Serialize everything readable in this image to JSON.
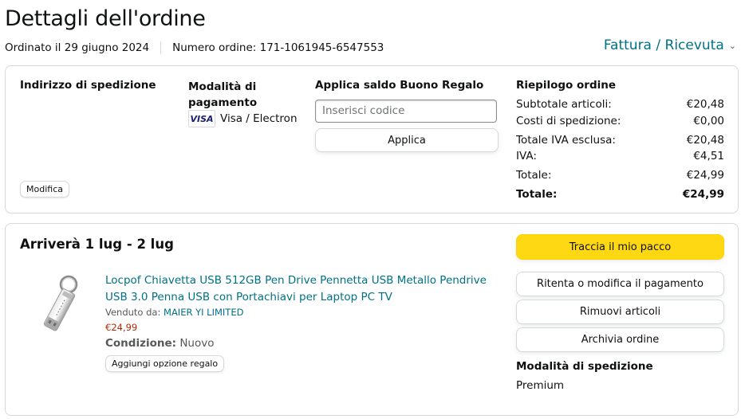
{
  "page": {
    "title": "Dettagli dell'ordine",
    "ordered_on": "Ordinato il 29 giugno 2024",
    "order_number": "Numero ordine: 171-1061945-6547553",
    "invoice_link": "Fattura / Ricevuta"
  },
  "summary": {
    "shipping_address_title": "Indirizzo di spedizione",
    "edit_button": "Modifica",
    "payment_title": "Modalità di pagamento",
    "card_brand": "VISA",
    "payment_method": "Visa / Electron",
    "gift_title": "Applica saldo Buono Regalo",
    "gift_placeholder": "Inserisci codice",
    "gift_apply": "Applica",
    "order_summary_title": "Riepilogo ordine",
    "rows": [
      {
        "label": "Subtotale articoli:",
        "value": "€20,48"
      },
      {
        "label": "Costi di spedizione:",
        "value": "€0,00"
      },
      {
        "label": "Totale IVA esclusa:",
        "value": "€20,48"
      },
      {
        "label": "IVA:",
        "value": "€4,51"
      },
      {
        "label": "Totale:",
        "value": "€24,99"
      }
    ],
    "grand_total_label": "Totale:",
    "grand_total_value": "€24,99"
  },
  "shipment": {
    "delivery_title": "Arriverà 1 lug - 2 lug",
    "product_title": "Locpof Chiavetta USB 512GB Pen Drive Pennetta USB Metallo Pendrive USB 3.0 Penna USB con Portachiavi per Laptop PC TV",
    "sold_by_label": "Venduto da:",
    "seller": "MAIER YI LIMITED",
    "price": "€24,99",
    "condition_label": "Condizione:",
    "condition_value": "Nuovo",
    "gift_option": "Aggiungi opzione regalo",
    "actions": {
      "track": "Traccia il mio pacco",
      "retry_payment": "Ritenta o modifica il pagamento",
      "remove_items": "Rimuovi articoli",
      "archive": "Archivia ordine"
    },
    "shipping_mode_title": "Modalità di spedizione",
    "shipping_mode_value": "Premium"
  },
  "icons": {
    "invoice_chevron": "chevron-down-icon",
    "product_image": "usb-drive-image"
  },
  "colors": {
    "link": "#007185",
    "primary_button": "#FFD814",
    "price": "#B12704",
    "border": "#D5D9D9"
  }
}
